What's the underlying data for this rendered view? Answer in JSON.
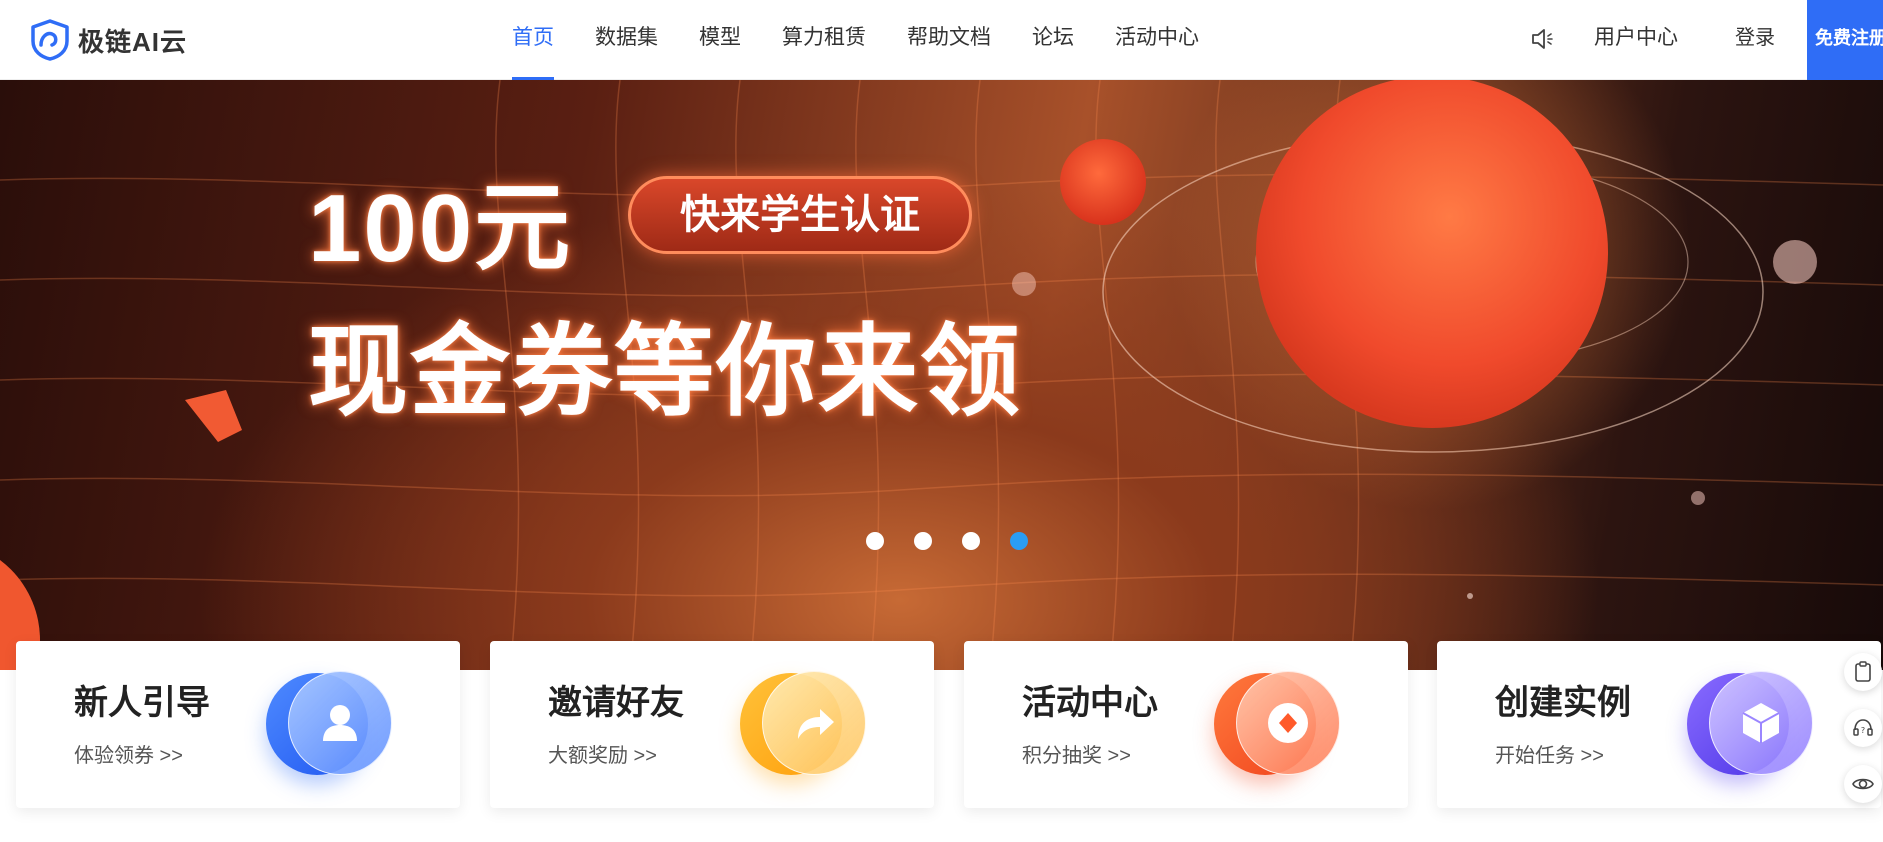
{
  "header": {
    "logo_text": "极链AI云",
    "nav": [
      {
        "label": "首页",
        "active": true
      },
      {
        "label": "数据集",
        "active": false
      },
      {
        "label": "模型",
        "active": false
      },
      {
        "label": "算力租赁",
        "active": false
      },
      {
        "label": "帮助文档",
        "active": false
      },
      {
        "label": "论坛",
        "active": false
      },
      {
        "label": "活动中心",
        "active": false
      }
    ],
    "speaker_icon": "speaker-icon",
    "user_center": "用户中心",
    "login": "登录",
    "register": "免费注册"
  },
  "banner": {
    "headline_line1": "100元",
    "pill_text": "快来学生认证",
    "headline_line2": "现金券等你来领",
    "slide_count": 4,
    "active_slide": 4
  },
  "cards": [
    {
      "title": "新人引导",
      "subtitle": "体验领券 >>",
      "icon": "user-icon",
      "color": "#2f6df6"
    },
    {
      "title": "邀请好友",
      "subtitle": "大额奖励 >>",
      "icon": "share-arrow-icon",
      "color": "#ffb21a"
    },
    {
      "title": "活动中心",
      "subtitle": "积分抽奖 >>",
      "icon": "diamond-coin-icon",
      "color": "#ff5a2a"
    },
    {
      "title": "创建实例",
      "subtitle": "开始任务 >>",
      "icon": "cube-icon",
      "color": "#6a4df6"
    }
  ],
  "side_buttons": [
    "clipboard-icon",
    "headset-help-icon",
    "eye-icon"
  ],
  "colors": {
    "accent": "#2f6df6",
    "active_dot": "#2a9df4"
  }
}
